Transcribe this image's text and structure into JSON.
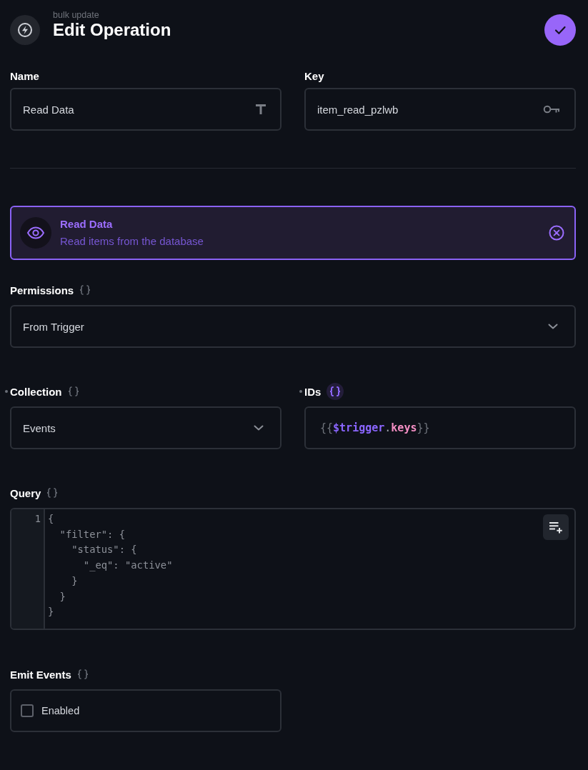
{
  "header": {
    "subtitle": "bulk update",
    "title": "Edit Operation"
  },
  "name_field": {
    "label": "Name",
    "value": "Read Data"
  },
  "key_field": {
    "label": "Key",
    "value": "item_read_pzlwb"
  },
  "operation": {
    "title": "Read Data",
    "description": "Read items from the database",
    "selected": true
  },
  "permissions": {
    "label": "Permissions",
    "raw": false,
    "value": "From Trigger"
  },
  "collection": {
    "label": "Collection",
    "required": true,
    "raw": false,
    "value": "Events"
  },
  "ids": {
    "label": "IDs",
    "required": true,
    "raw": true,
    "tokens": [
      {
        "kind": "brace",
        "text": "{{"
      },
      {
        "kind": "variable",
        "text": "$trigger"
      },
      {
        "kind": "punctuation",
        "text": "."
      },
      {
        "kind": "property",
        "text": "keys"
      },
      {
        "kind": "brace",
        "text": "}}"
      }
    ]
  },
  "query": {
    "label": "Query",
    "raw": false,
    "line_numbers": [
      "1"
    ],
    "code_lines": [
      "{",
      "  \"filter\": {",
      "    \"status\": {",
      "      \"_eq\": \"active\"",
      "    }",
      "  }",
      "}"
    ]
  },
  "emit_events": {
    "label": "Emit Events",
    "raw": false,
    "option": "Enabled",
    "checked": false
  }
}
